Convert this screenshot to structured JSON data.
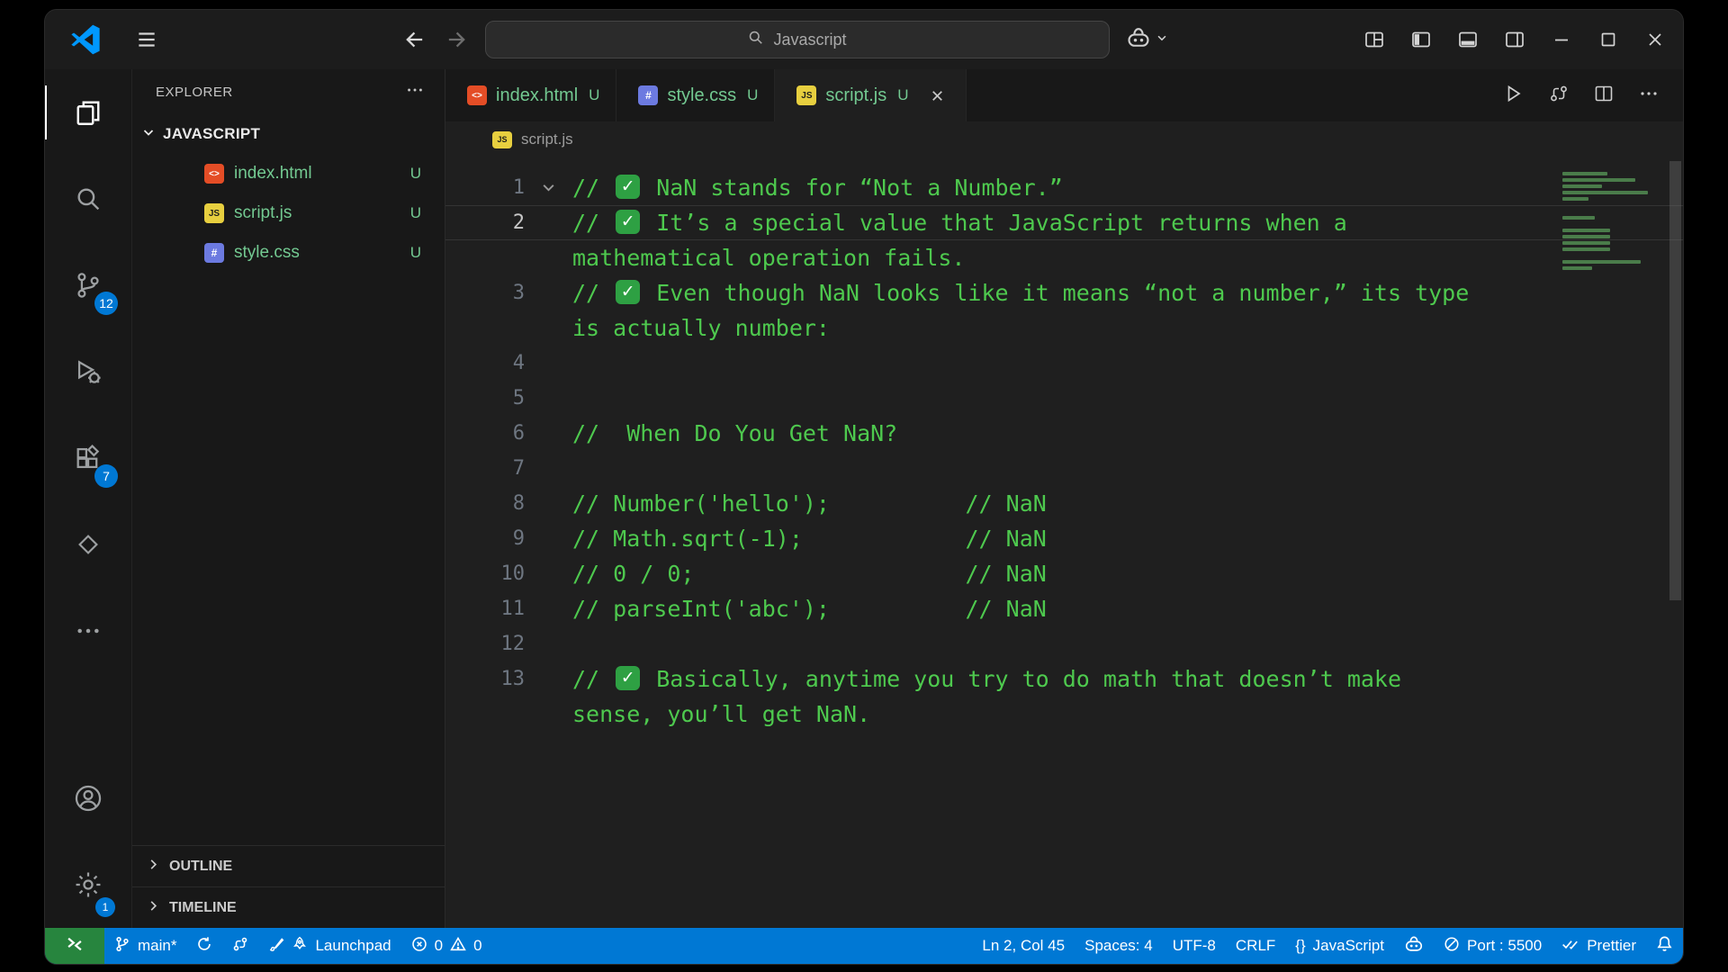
{
  "colors": {
    "accent": "#0078d4",
    "statusbar_bg": "#0078d4",
    "remote_tile_bg": "#27853e",
    "chrome_bg": "#181818",
    "editor_bg": "#1f1f1f",
    "comment_green": "#4ec94e",
    "untracked_green": "#73c991",
    "badge_blue": "#0078d4",
    "check_green": "#2ea043"
  },
  "titlebar": {
    "search_text": "Javascript"
  },
  "activity_bar": {
    "badges": {
      "source_control": "12",
      "extensions": "7",
      "settings": "1"
    }
  },
  "file_icons": {
    "html": "<>",
    "js": "JS",
    "css": "#"
  },
  "sidebar": {
    "title": "EXPLORER",
    "folder": "JAVASCRIPT",
    "files": [
      {
        "name": "index.html",
        "git": "U"
      },
      {
        "name": "script.js",
        "git": "U"
      },
      {
        "name": "style.css",
        "git": "U"
      }
    ],
    "panels": {
      "outline": "OUTLINE",
      "timeline": "TIMELINE"
    }
  },
  "tabs": [
    {
      "name": "index.html",
      "git": "U"
    },
    {
      "name": "style.css",
      "git": "U"
    },
    {
      "name": "script.js",
      "git": "U"
    }
  ],
  "breadcrumb": {
    "file": "script.js"
  },
  "editor": {
    "lines": [
      {
        "n": "1",
        "fold": true,
        "rows": [
          {
            "check": true,
            "pre": "// ",
            "text": "NaN stands for “Not a Number.”"
          }
        ]
      },
      {
        "n": "2",
        "active": true,
        "rows": [
          {
            "check": true,
            "pre": "// ",
            "text": "It’s a special value that JavaScript returns when a"
          },
          {
            "text": "mathematical operation fails."
          }
        ]
      },
      {
        "n": "3",
        "rows": [
          {
            "check": true,
            "pre": "// ",
            "text": "Even though NaN looks like it means “not a number,” its type"
          },
          {
            "text": "is actually number:"
          }
        ]
      },
      {
        "n": "4",
        "rows": [
          {
            "text": ""
          }
        ]
      },
      {
        "n": "5",
        "rows": [
          {
            "text": ""
          }
        ]
      },
      {
        "n": "6",
        "rows": [
          {
            "text": "//  When Do You Get NaN?"
          }
        ]
      },
      {
        "n": "7",
        "rows": [
          {
            "text": ""
          }
        ]
      },
      {
        "n": "8",
        "rows": [
          {
            "text": "// Number('hello');          // NaN"
          }
        ]
      },
      {
        "n": "9",
        "rows": [
          {
            "text": "// Math.sqrt(-1);            // NaN"
          }
        ]
      },
      {
        "n": "10",
        "rows": [
          {
            "text": "// 0 / 0;                    // NaN"
          }
        ]
      },
      {
        "n": "11",
        "rows": [
          {
            "text": "// parseInt('abc');          // NaN"
          }
        ]
      },
      {
        "n": "12",
        "rows": [
          {
            "text": ""
          }
        ]
      },
      {
        "n": "13",
        "rows": [
          {
            "check": true,
            "pre": "// ",
            "text": "Basically, anytime you try to do math that doesn’t make"
          },
          {
            "text": "sense, you’ll get NaN."
          }
        ]
      }
    ]
  },
  "status_bar": {
    "branch": "main*",
    "launchpad": "Launchpad",
    "errors": "0",
    "warnings": "0",
    "line_col": "Ln 2, Col 45",
    "indent": "Spaces: 4",
    "encoding": "UTF-8",
    "eol": "CRLF",
    "language_icon": "{}",
    "language": "JavaScript",
    "port": "Port : 5500",
    "formatter": "Prettier"
  }
}
